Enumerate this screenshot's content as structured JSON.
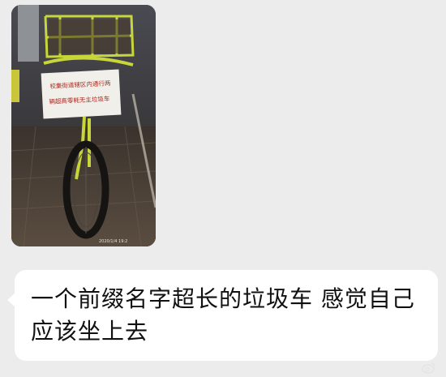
{
  "photo_message": {
    "sign_line_1": "校集街道辖区内通行两",
    "sign_line_2": "辆超高零耗无主垃圾车",
    "timestamp": "2020/1/4 19:2"
  },
  "text_message": {
    "text": "一个前缀名字超长的垃圾车 感觉自己应该坐上去"
  },
  "watermark": {
    "icon": "weibo-icon",
    "text": ""
  },
  "colors": {
    "chat_background": "#ececec",
    "bubble": "#ffffff",
    "bike_frame": "#c8d63a",
    "sign_text": "#b0281f"
  }
}
